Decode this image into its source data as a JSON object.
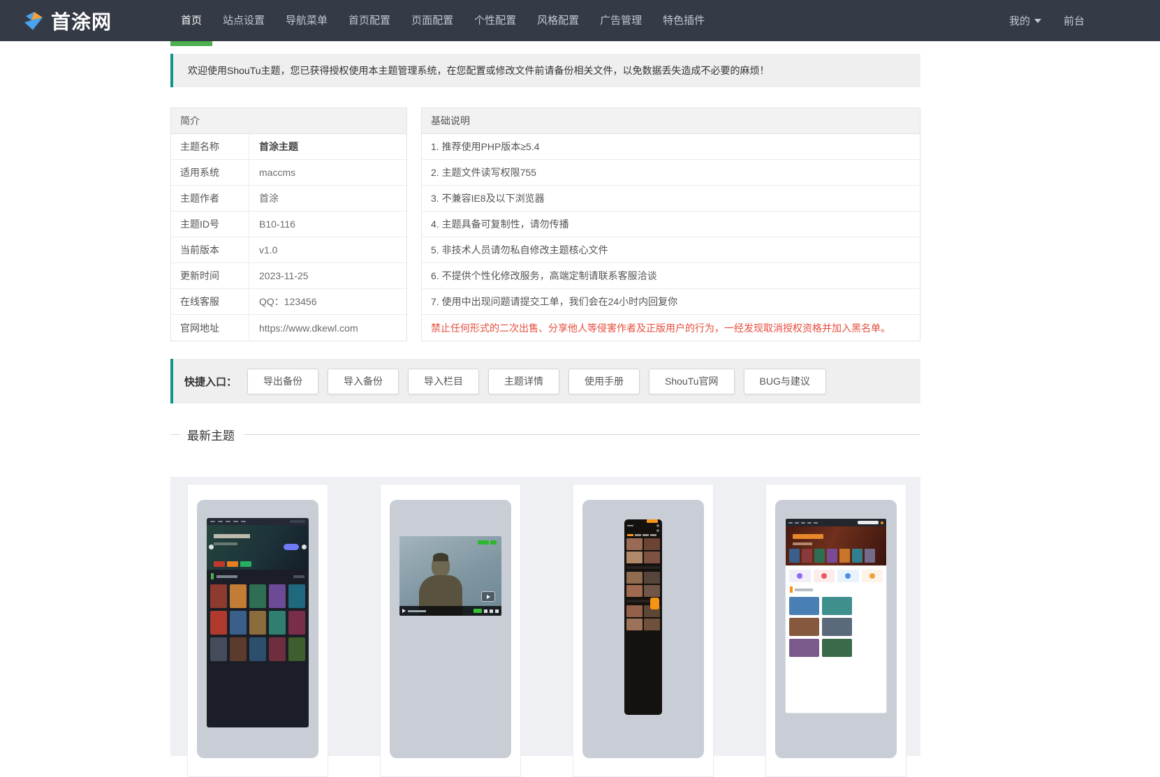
{
  "colors": {
    "navbar_bg": "#343a46",
    "nav_active_underline": "#4cb050",
    "section_accent_teal": "#0f9688",
    "danger_text": "#e74c3c",
    "banner_bg": "#efefef",
    "themes_panel_bg": "#eef0f3",
    "thumbnail_bg": "#c9ced6"
  },
  "navbar": {
    "brand": "首涂网",
    "items": [
      {
        "label": "首页",
        "active": true
      },
      {
        "label": "站点设置",
        "active": false
      },
      {
        "label": "导航菜单",
        "active": false
      },
      {
        "label": "首页配置",
        "active": false
      },
      {
        "label": "页面配置",
        "active": false
      },
      {
        "label": "个性配置",
        "active": false
      },
      {
        "label": "风格配置",
        "active": false
      },
      {
        "label": "广告管理",
        "active": false
      },
      {
        "label": "特色插件",
        "active": false
      }
    ],
    "user_menu": "我的",
    "frontend_link": "前台"
  },
  "welcome": {
    "message": "欢迎使用ShouTu主题，您已获得授权使用本主题管理系统，在您配置或修改文件前请备份相关文件，以免数据丢失造成不必要的麻烦！"
  },
  "intro_table": {
    "title": "简介",
    "rows": [
      {
        "label": "主题名称",
        "value": "首涂主题"
      },
      {
        "label": "适用系统",
        "value": "maccms"
      },
      {
        "label": "主题作者",
        "value": "首涂"
      },
      {
        "label": "主题ID号",
        "value": "B10-116"
      },
      {
        "label": "当前版本",
        "value": "v1.0"
      },
      {
        "label": "更新时间",
        "value": "2023-11-25"
      },
      {
        "label": "在线客服",
        "value": "QQ：123456"
      },
      {
        "label": "官网地址",
        "value": "https://www.dkewl.com"
      }
    ]
  },
  "notes_table": {
    "title": "基础说明",
    "rows": [
      "1. 推荐使用PHP版本≥5.4",
      "2. 主题文件读写权限755",
      "3. 不兼容IE8及以下浏览器",
      "4. 主题具备可复制性，请勿传播",
      "5. 非技术人员请勿私自修改主题核心文件",
      "6. 不提供个性化修改服务，高端定制请联系客服洽谈",
      "7. 使用中出现问题请提交工单，我们会在24小时内回复你"
    ],
    "warning": "禁止任何形式的二次出售、分享他人等侵害作者及正版用户的行为，一经发现取消授权资格并加入黑名单。"
  },
  "quick_entry": {
    "label": "快捷入口：",
    "buttons": [
      "导出备份",
      "导入备份",
      "导入栏目",
      "主题详情",
      "使用手册",
      "ShouTu官网",
      "BUG与建议"
    ]
  },
  "latest_themes": {
    "title": "最新主题",
    "cards": [
      {
        "name": "desktop-dark-theme-preview"
      },
      {
        "name": "video-player-theme-preview"
      },
      {
        "name": "mobile-app-theme-preview"
      },
      {
        "name": "desktop-light-theme-preview"
      }
    ]
  }
}
